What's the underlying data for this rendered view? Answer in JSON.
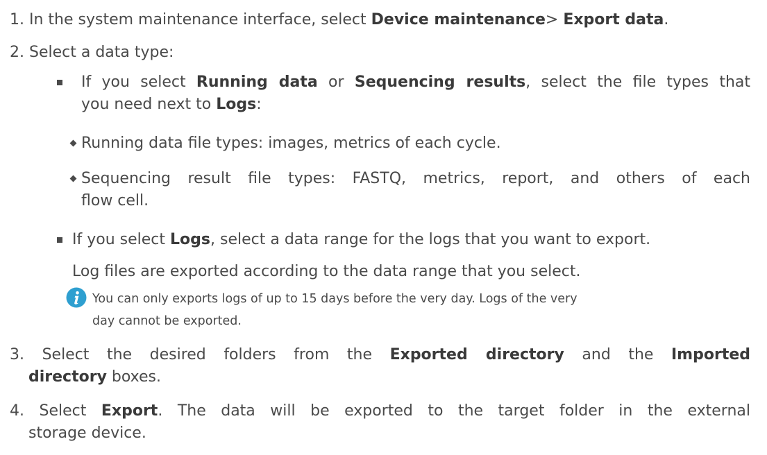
{
  "steps": [
    {
      "number": "1.",
      "prefix": "In the system maintenance interface, select ",
      "bold1": "Device maintenance",
      "middle": "> ",
      "bold2": "Export data",
      "suffix": "."
    },
    {
      "number": "2.",
      "text": "Select a data type:",
      "bullets": [
        {
          "line1_prefix": "If you select ",
          "line1_bold1": "Running data",
          "line1_mid": " or ",
          "line1_bold2": "Sequencing results",
          "line1_suffix": ", select the file types that",
          "line2_prefix": "you need next to ",
          "line2_bold": "Logs",
          "line2_suffix": ":",
          "sub_items": [
            {
              "line1": "Running data file types: images, metrics of each cycle."
            },
            {
              "line1": "Sequencing result file types: FASTQ, metrics, report, and others of each",
              "line2": "flow cell."
            }
          ]
        },
        {
          "line1_prefix": "If you select ",
          "line1_bold": "Logs",
          "line1_suffix": ", select a data range for the logs that you want to export.",
          "para": "Log files are exported according to the data range that you select.",
          "note_line1": "You can only exports logs of up to 15 days before the very day. Logs of the very",
          "note_line2": "day cannot be exported.",
          "note_icon": "info-icon"
        }
      ]
    },
    {
      "number": "3.",
      "line1_prefix": "Select the desired folders from the ",
      "line1_bold1": "Exported directory",
      "line1_mid": " and the ",
      "line1_bold2": "Imported",
      "line2_bold": "directory",
      "line2_suffix": " boxes."
    },
    {
      "number": "4.",
      "line1_prefix": "Select ",
      "line1_bold": "Export",
      "line1_suffix": ". The data will be exported to the target folder in the external",
      "line2": "storage device."
    }
  ],
  "colors": {
    "text": "#4a4a4a",
    "icon": "#2e9fd0"
  }
}
